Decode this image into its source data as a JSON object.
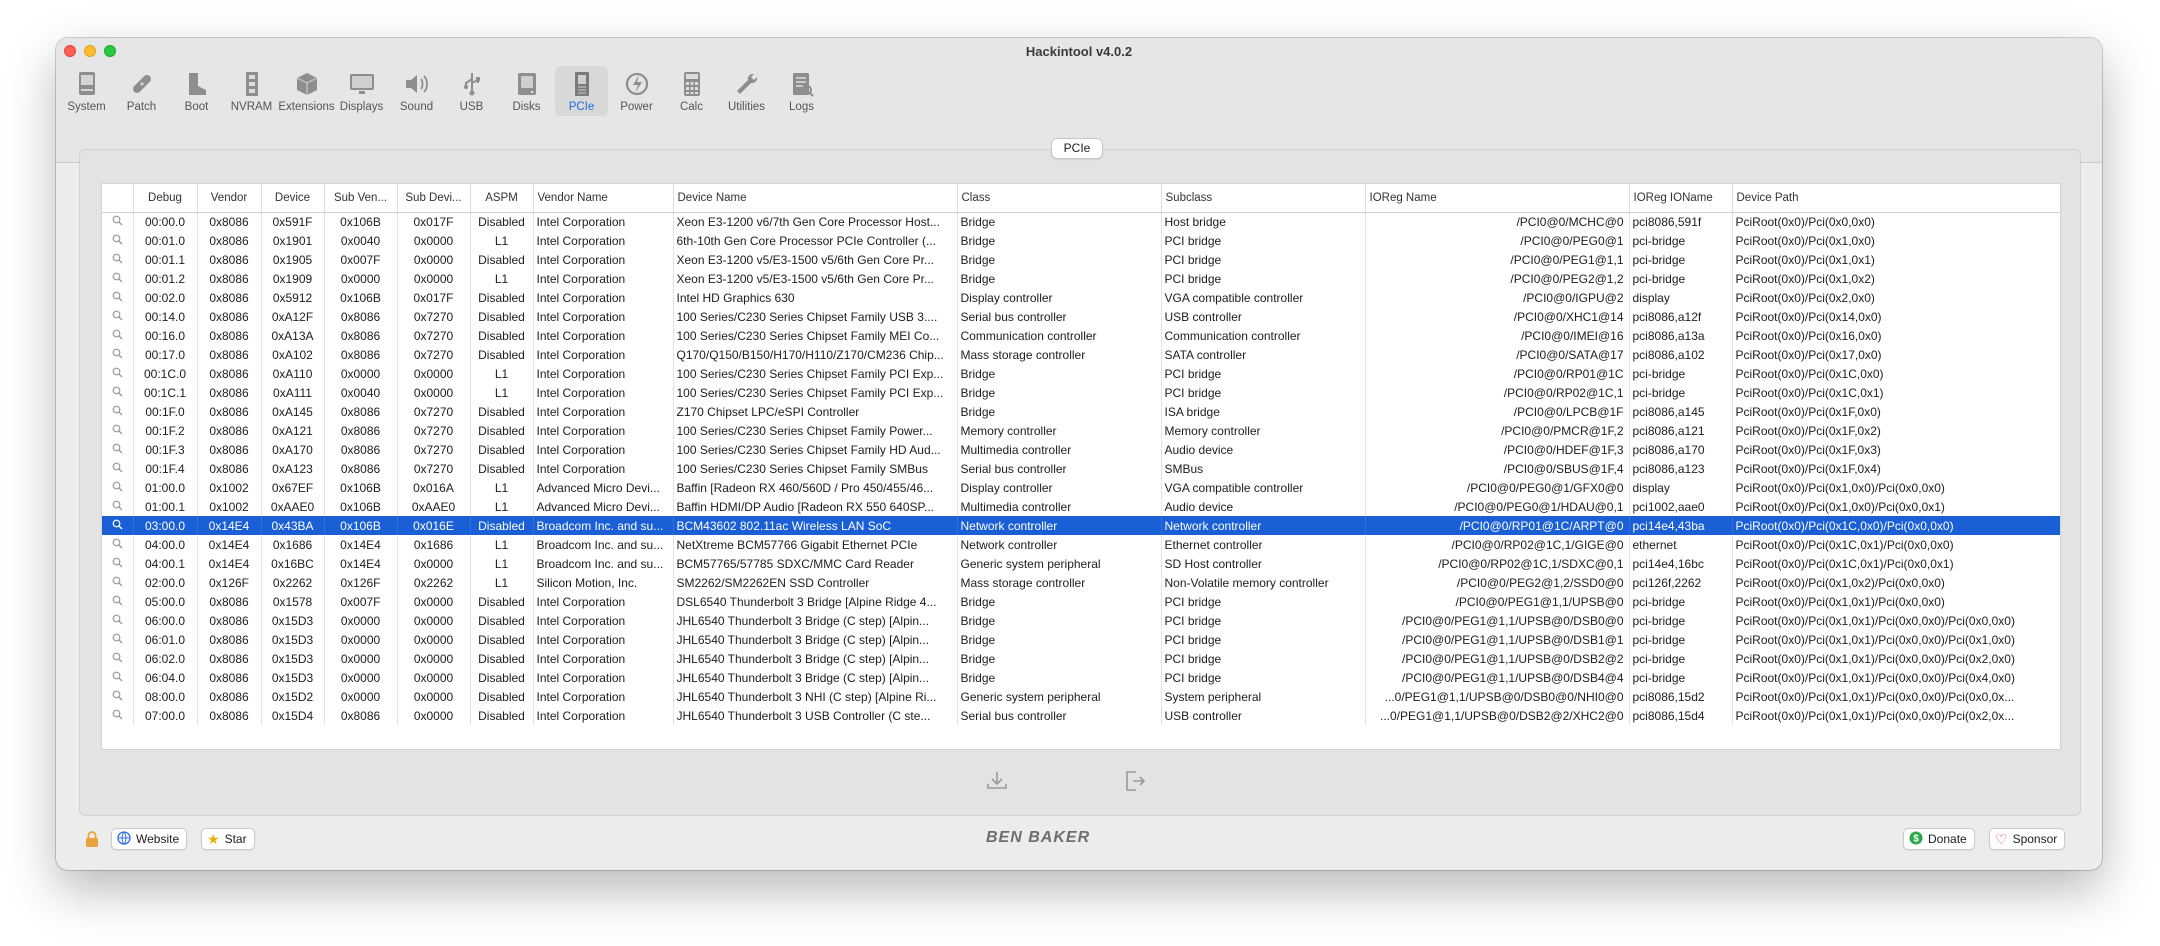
{
  "window": {
    "title": "Hackintool v4.0.2"
  },
  "toolbar": [
    {
      "label": "System",
      "icon": "system-icon"
    },
    {
      "label": "Patch",
      "icon": "patch-icon"
    },
    {
      "label": "Boot",
      "icon": "boot-icon"
    },
    {
      "label": "NVRAM",
      "icon": "nvram-icon"
    },
    {
      "label": "Extensions",
      "icon": "extensions-icon"
    },
    {
      "label": "Displays",
      "icon": "displays-icon"
    },
    {
      "label": "Sound",
      "icon": "sound-icon"
    },
    {
      "label": "USB",
      "icon": "usb-icon"
    },
    {
      "label": "Disks",
      "icon": "disks-icon"
    },
    {
      "label": "PCIe",
      "icon": "pcie-icon",
      "active": true
    },
    {
      "label": "Power",
      "icon": "power-icon"
    },
    {
      "label": "Calc",
      "icon": "calc-icon"
    },
    {
      "label": "Utilities",
      "icon": "utilities-icon"
    },
    {
      "label": "Logs",
      "icon": "logs-icon"
    }
  ],
  "tab": {
    "label": "PCIe"
  },
  "table": {
    "columns": [
      "",
      "Debug",
      "Vendor",
      "Device",
      "Sub Ven...",
      "Sub Devi...",
      "ASPM",
      "Vendor Name",
      "Device Name",
      "Class",
      "Subclass",
      "IOReg Name",
      "IOReg IOName",
      "Device Path"
    ],
    "selected_index": 16,
    "rows": [
      [
        "00:00.0",
        "0x8086",
        "0x591F",
        "0x106B",
        "0x017F",
        "Disabled",
        "Intel Corporation",
        "Xeon E3-1200 v6/7th Gen Core Processor Host...",
        "Bridge",
        "Host bridge",
        "/PCI0@0/MCHC@0",
        "pci8086,591f",
        "PciRoot(0x0)/Pci(0x0,0x0)"
      ],
      [
        "00:01.0",
        "0x8086",
        "0x1901",
        "0x0040",
        "0x0000",
        "L1",
        "Intel Corporation",
        "6th-10th Gen Core Processor PCIe Controller (...",
        "Bridge",
        "PCI bridge",
        "/PCI0@0/PEG0@1",
        "pci-bridge",
        "PciRoot(0x0)/Pci(0x1,0x0)"
      ],
      [
        "00:01.1",
        "0x8086",
        "0x1905",
        "0x007F",
        "0x0000",
        "Disabled",
        "Intel Corporation",
        "Xeon E3-1200 v5/E3-1500 v5/6th Gen Core Pr...",
        "Bridge",
        "PCI bridge",
        "/PCI0@0/PEG1@1,1",
        "pci-bridge",
        "PciRoot(0x0)/Pci(0x1,0x1)"
      ],
      [
        "00:01.2",
        "0x8086",
        "0x1909",
        "0x0000",
        "0x0000",
        "L1",
        "Intel Corporation",
        "Xeon E3-1200 v5/E3-1500 v5/6th Gen Core Pr...",
        "Bridge",
        "PCI bridge",
        "/PCI0@0/PEG2@1,2",
        "pci-bridge",
        "PciRoot(0x0)/Pci(0x1,0x2)"
      ],
      [
        "00:02.0",
        "0x8086",
        "0x5912",
        "0x106B",
        "0x017F",
        "Disabled",
        "Intel Corporation",
        "Intel HD Graphics 630",
        "Display controller",
        "VGA compatible controller",
        "/PCI0@0/IGPU@2",
        "display",
        "PciRoot(0x0)/Pci(0x2,0x0)"
      ],
      [
        "00:14.0",
        "0x8086",
        "0xA12F",
        "0x8086",
        "0x7270",
        "Disabled",
        "Intel Corporation",
        "100 Series/C230 Series Chipset Family USB 3....",
        "Serial bus controller",
        "USB controller",
        "/PCI0@0/XHC1@14",
        "pci8086,a12f",
        "PciRoot(0x0)/Pci(0x14,0x0)"
      ],
      [
        "00:16.0",
        "0x8086",
        "0xA13A",
        "0x8086",
        "0x7270",
        "Disabled",
        "Intel Corporation",
        "100 Series/C230 Series Chipset Family MEI Co...",
        "Communication controller",
        "Communication controller",
        "/PCI0@0/IMEI@16",
        "pci8086,a13a",
        "PciRoot(0x0)/Pci(0x16,0x0)"
      ],
      [
        "00:17.0",
        "0x8086",
        "0xA102",
        "0x8086",
        "0x7270",
        "Disabled",
        "Intel Corporation",
        "Q170/Q150/B150/H170/H110/Z170/CM236 Chip...",
        "Mass storage controller",
        "SATA controller",
        "/PCI0@0/SATA@17",
        "pci8086,a102",
        "PciRoot(0x0)/Pci(0x17,0x0)"
      ],
      [
        "00:1C.0",
        "0x8086",
        "0xA110",
        "0x0000",
        "0x0000",
        "L1",
        "Intel Corporation",
        "100 Series/C230 Series Chipset Family PCI Exp...",
        "Bridge",
        "PCI bridge",
        "/PCI0@0/RP01@1C",
        "pci-bridge",
        "PciRoot(0x0)/Pci(0x1C,0x0)"
      ],
      [
        "00:1C.1",
        "0x8086",
        "0xA111",
        "0x0040",
        "0x0000",
        "L1",
        "Intel Corporation",
        "100 Series/C230 Series Chipset Family PCI Exp...",
        "Bridge",
        "PCI bridge",
        "/PCI0@0/RP02@1C,1",
        "pci-bridge",
        "PciRoot(0x0)/Pci(0x1C,0x1)"
      ],
      [
        "00:1F.0",
        "0x8086",
        "0xA145",
        "0x8086",
        "0x7270",
        "Disabled",
        "Intel Corporation",
        "Z170 Chipset LPC/eSPI Controller",
        "Bridge",
        "ISA bridge",
        "/PCI0@0/LPCB@1F",
        "pci8086,a145",
        "PciRoot(0x0)/Pci(0x1F,0x0)"
      ],
      [
        "00:1F.2",
        "0x8086",
        "0xA121",
        "0x8086",
        "0x7270",
        "Disabled",
        "Intel Corporation",
        "100 Series/C230 Series Chipset Family Power...",
        "Memory controller",
        "Memory controller",
        "/PCI0@0/PMCR@1F,2",
        "pci8086,a121",
        "PciRoot(0x0)/Pci(0x1F,0x2)"
      ],
      [
        "00:1F.3",
        "0x8086",
        "0xA170",
        "0x8086",
        "0x7270",
        "Disabled",
        "Intel Corporation",
        "100 Series/C230 Series Chipset Family HD Aud...",
        "Multimedia controller",
        "Audio device",
        "/PCI0@0/HDEF@1F,3",
        "pci8086,a170",
        "PciRoot(0x0)/Pci(0x1F,0x3)"
      ],
      [
        "00:1F.4",
        "0x8086",
        "0xA123",
        "0x8086",
        "0x7270",
        "Disabled",
        "Intel Corporation",
        "100 Series/C230 Series Chipset Family SMBus",
        "Serial bus controller",
        "SMBus",
        "/PCI0@0/SBUS@1F,4",
        "pci8086,a123",
        "PciRoot(0x0)/Pci(0x1F,0x4)"
      ],
      [
        "01:00.0",
        "0x1002",
        "0x67EF",
        "0x106B",
        "0x016A",
        "L1",
        "Advanced Micro Devi...",
        "Baffin [Radeon RX 460/560D / Pro 450/455/46...",
        "Display controller",
        "VGA compatible controller",
        "/PCI0@0/PEG0@1/GFX0@0",
        "display",
        "PciRoot(0x0)/Pci(0x1,0x0)/Pci(0x0,0x0)"
      ],
      [
        "01:00.1",
        "0x1002",
        "0xAAE0",
        "0x106B",
        "0xAAE0",
        "L1",
        "Advanced Micro Devi...",
        "Baffin HDMI/DP Audio [Radeon RX 550 640SP...",
        "Multimedia controller",
        "Audio device",
        "/PCI0@0/PEG0@1/HDAU@0,1",
        "pci1002,aae0",
        "PciRoot(0x0)/Pci(0x1,0x0)/Pci(0x0,0x1)"
      ],
      [
        "03:00.0",
        "0x14E4",
        "0x43BA",
        "0x106B",
        "0x016E",
        "Disabled",
        "Broadcom Inc. and su...",
        "BCM43602 802.11ac Wireless LAN SoC",
        "Network controller",
        "Network controller",
        "/PCI0@0/RP01@1C/ARPT@0",
        "pci14e4,43ba",
        "PciRoot(0x0)/Pci(0x1C,0x0)/Pci(0x0,0x0)"
      ],
      [
        "04:00.0",
        "0x14E4",
        "0x1686",
        "0x14E4",
        "0x1686",
        "L1",
        "Broadcom Inc. and su...",
        "NetXtreme BCM57766 Gigabit Ethernet PCIe",
        "Network controller",
        "Ethernet controller",
        "/PCI0@0/RP02@1C,1/GIGE@0",
        "ethernet",
        "PciRoot(0x0)/Pci(0x1C,0x1)/Pci(0x0,0x0)"
      ],
      [
        "04:00.1",
        "0x14E4",
        "0x16BC",
        "0x14E4",
        "0x0000",
        "L1",
        "Broadcom Inc. and su...",
        "BCM57765/57785 SDXC/MMC Card Reader",
        "Generic system peripheral",
        "SD Host controller",
        "/PCI0@0/RP02@1C,1/SDXC@0,1",
        "pci14e4,16bc",
        "PciRoot(0x0)/Pci(0x1C,0x1)/Pci(0x0,0x1)"
      ],
      [
        "02:00.0",
        "0x126F",
        "0x2262",
        "0x126F",
        "0x2262",
        "L1",
        "Silicon Motion, Inc.",
        "SM2262/SM2262EN SSD Controller",
        "Mass storage controller",
        "Non-Volatile memory controller",
        "/PCI0@0/PEG2@1,2/SSD0@0",
        "pci126f,2262",
        "PciRoot(0x0)/Pci(0x1,0x2)/Pci(0x0,0x0)"
      ],
      [
        "05:00.0",
        "0x8086",
        "0x1578",
        "0x007F",
        "0x0000",
        "Disabled",
        "Intel Corporation",
        "DSL6540 Thunderbolt 3 Bridge [Alpine Ridge 4...",
        "Bridge",
        "PCI bridge",
        "/PCI0@0/PEG1@1,1/UPSB@0",
        "pci-bridge",
        "PciRoot(0x0)/Pci(0x1,0x1)/Pci(0x0,0x0)"
      ],
      [
        "06:00.0",
        "0x8086",
        "0x15D3",
        "0x0000",
        "0x0000",
        "Disabled",
        "Intel Corporation",
        "JHL6540 Thunderbolt 3 Bridge (C step) [Alpin...",
        "Bridge",
        "PCI bridge",
        "/PCI0@0/PEG1@1,1/UPSB@0/DSB0@0",
        "pci-bridge",
        "PciRoot(0x0)/Pci(0x1,0x1)/Pci(0x0,0x0)/Pci(0x0,0x0)"
      ],
      [
        "06:01.0",
        "0x8086",
        "0x15D3",
        "0x0000",
        "0x0000",
        "Disabled",
        "Intel Corporation",
        "JHL6540 Thunderbolt 3 Bridge (C step) [Alpin...",
        "Bridge",
        "PCI bridge",
        "/PCI0@0/PEG1@1,1/UPSB@0/DSB1@1",
        "pci-bridge",
        "PciRoot(0x0)/Pci(0x1,0x1)/Pci(0x0,0x0)/Pci(0x1,0x0)"
      ],
      [
        "06:02.0",
        "0x8086",
        "0x15D3",
        "0x0000",
        "0x0000",
        "Disabled",
        "Intel Corporation",
        "JHL6540 Thunderbolt 3 Bridge (C step) [Alpin...",
        "Bridge",
        "PCI bridge",
        "/PCI0@0/PEG1@1,1/UPSB@0/DSB2@2",
        "pci-bridge",
        "PciRoot(0x0)/Pci(0x1,0x1)/Pci(0x0,0x0)/Pci(0x2,0x0)"
      ],
      [
        "06:04.0",
        "0x8086",
        "0x15D3",
        "0x0000",
        "0x0000",
        "Disabled",
        "Intel Corporation",
        "JHL6540 Thunderbolt 3 Bridge (C step) [Alpin...",
        "Bridge",
        "PCI bridge",
        "/PCI0@0/PEG1@1,1/UPSB@0/DSB4@4",
        "pci-bridge",
        "PciRoot(0x0)/Pci(0x1,0x1)/Pci(0x0,0x0)/Pci(0x4,0x0)"
      ],
      [
        "08:00.0",
        "0x8086",
        "0x15D2",
        "0x0000",
        "0x0000",
        "Disabled",
        "Intel Corporation",
        "JHL6540 Thunderbolt 3 NHI (C step) [Alpine Ri...",
        "Generic system peripheral",
        "System peripheral",
        "...0/PEG1@1,1/UPSB@0/DSB0@0/NHI0@0",
        "pci8086,15d2",
        "PciRoot(0x0)/Pci(0x1,0x1)/Pci(0x0,0x0)/Pci(0x0,0x..."
      ],
      [
        "07:00.0",
        "0x8086",
        "0x15D4",
        "0x8086",
        "0x0000",
        "Disabled",
        "Intel Corporation",
        "JHL6540 Thunderbolt 3 USB Controller (C ste...",
        "Serial bus controller",
        "USB controller",
        "...0/PEG1@1,1/UPSB@0/DSB2@2/XHC2@0",
        "pci8086,15d4",
        "PciRoot(0x0)/Pci(0x1,0x1)/Pci(0x0,0x0)/Pci(0x2,0x..."
      ]
    ]
  },
  "actions": {
    "export_icon": "download-icon",
    "open_icon": "open-external-icon"
  },
  "footer": {
    "website_label": "Website",
    "star_label": "Star",
    "logo_text": "BEN BAKER",
    "donate_label": "Donate",
    "sponsor_label": "Sponsor"
  },
  "colors": {
    "selection": "#1a5fd6",
    "accent": "#1a6fe0"
  }
}
